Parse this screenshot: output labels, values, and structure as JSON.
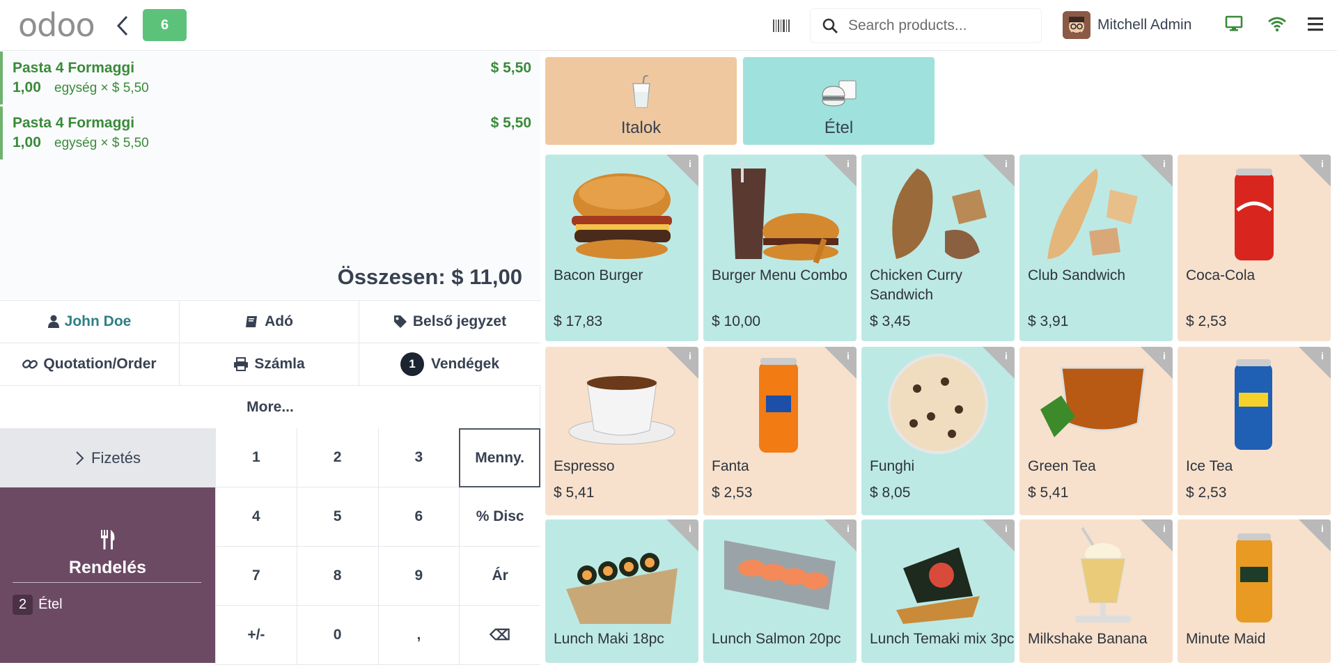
{
  "header": {
    "logo": "odoo",
    "order_count": "6",
    "search_placeholder": "Search products...",
    "user_name": "Mitchell Admin"
  },
  "order": {
    "lines": [
      {
        "name": "Pasta 4 Formaggi",
        "price": "$ 5,50",
        "qty": "1,00",
        "unit": "egység × $ 5,50"
      },
      {
        "name": "Pasta 4 Formaggi",
        "price": "$ 5,50",
        "qty": "1,00",
        "unit": "egység × $ 5,50"
      }
    ],
    "total": "Összesen: $ 11,00"
  },
  "controls": {
    "customer": "John Doe",
    "tax": "Adó",
    "internal_note": "Belső jegyzet",
    "quotation": "Quotation/Order",
    "invoice": "Számla",
    "guests_count": "1",
    "guests": "Vendégek",
    "more": "More..."
  },
  "payment": {
    "label": "Fizetés"
  },
  "kitchen": {
    "title": "Rendelés",
    "category_count": "2",
    "category": "Étel"
  },
  "numpad": {
    "keys": [
      "1",
      "2",
      "3",
      "Menny.",
      "4",
      "5",
      "6",
      "% Disc",
      "7",
      "8",
      "9",
      "Ár",
      "+/-",
      "0",
      ",",
      "⌫"
    ]
  },
  "categories": [
    {
      "label": "Italok"
    },
    {
      "label": "Étel"
    }
  ],
  "products": [
    {
      "name": "Bacon Burger",
      "price": "$ 17,83"
    },
    {
      "name": "Burger Menu Combo",
      "price": "$ 10,00"
    },
    {
      "name": "Chicken Curry Sandwich",
      "price": "$ 3,45"
    },
    {
      "name": "Club Sandwich",
      "price": "$ 3,91"
    },
    {
      "name": "Coca-Cola",
      "price": "$ 2,53"
    },
    {
      "name": "Espresso",
      "price": "$ 5,41"
    },
    {
      "name": "Fanta",
      "price": "$ 2,53"
    },
    {
      "name": "Funghi",
      "price": "$ 8,05"
    },
    {
      "name": "Green Tea",
      "price": "$ 5,41"
    },
    {
      "name": "Ice Tea",
      "price": "$ 2,53"
    },
    {
      "name": "Lunch Maki 18pc",
      "price": ""
    },
    {
      "name": "Lunch Salmon 20pc",
      "price": ""
    },
    {
      "name": "Lunch Temaki mix 3pc",
      "price": ""
    },
    {
      "name": "Milkshake Banana",
      "price": ""
    },
    {
      "name": "Minute Maid",
      "price": ""
    }
  ],
  "colors": {
    "accent": "#714b67",
    "food": "#bde9e5",
    "drink": "#f7e1cd",
    "badge": "#5cc27a"
  }
}
